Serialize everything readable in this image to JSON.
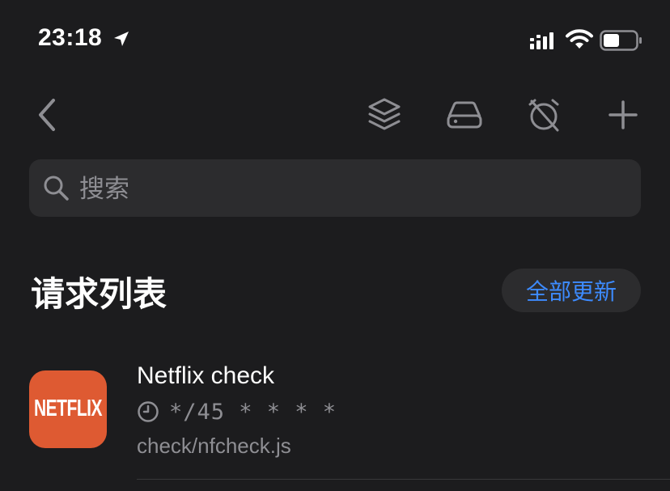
{
  "status_bar": {
    "time": "23:18",
    "icons": [
      "location-arrow-icon",
      "cellular-signal-icon",
      "wifi-icon",
      "battery-icon"
    ]
  },
  "nav": {
    "buttons": [
      "back-icon",
      "layers-icon",
      "drive-icon",
      "alarm-off-icon",
      "plus-icon"
    ]
  },
  "search": {
    "placeholder": "搜索",
    "value": ""
  },
  "section": {
    "title": "请求列表",
    "update_all_label": "全部更新"
  },
  "requests": [
    {
      "icon_text": "NETFLIX",
      "icon_color": "#de5a32",
      "title": "Netflix check",
      "cron": "*/45 * * * *",
      "path": "check/nfcheck.js"
    }
  ],
  "colors": {
    "background": "#1c1c1e",
    "surface": "#2c2c2e",
    "accent": "#3d8bff",
    "secondary_text": "#8e8e93",
    "nav_icon": "#8e8e93"
  }
}
